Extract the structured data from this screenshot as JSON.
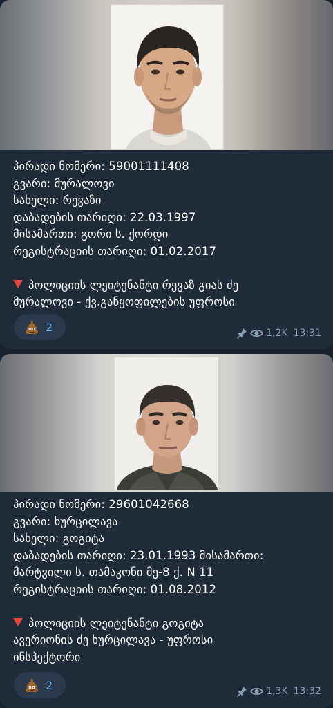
{
  "messages": [
    {
      "lines": [
        "პირადი ნომერი: 59001111408",
        "გვარი: მურალოვი",
        "სახელი: რევაზი",
        "დაბადების თარიღი: 22.03.1997",
        "მისამართი: გორი ს. ქორდი",
        "რეგისტრაციის თარიღი: 01.02.2017"
      ],
      "note_lines": [
        "პოლიციის ლეიტენანტი რევაზ გიას ძე",
        "მურალოვი - ქვ.განყოფილების უფროსი"
      ],
      "reaction_count": "2",
      "views": "1,2K",
      "time": "13:31"
    },
    {
      "lines": [
        "პირადი ნომერი: 29601042668",
        "გვარი: ხურცილავა",
        "სახელი: გოგიტა",
        "დაბადების თარიღი: 23.01.1993  მისამართი:",
        "მარტვილი ს. თამაკონი მე-8 ქ. N 11",
        "რეგისტრაციის თარიღი: 01.08.2012"
      ],
      "note_lines": [
        "პოლიციის ლეიტენანტი გოგიტა",
        "ავერიონის ძე ხურცილავა - უფროსი",
        "ინსპექტორი"
      ],
      "reaction_count": "2",
      "views": "1,3K",
      "time": "13:32"
    }
  ],
  "colors": {
    "background": "#18222d",
    "bubble": "#1f2b38",
    "reaction_bg": "#2a3a4c",
    "reaction_count": "#5eb5f7",
    "meta": "#8ea3b6",
    "triangle": "#e8453c"
  },
  "icons": {
    "reaction": "pile-of-poo-icon",
    "pin": "pin-icon",
    "views": "eye-icon",
    "note_marker": "red-triangle-down-icon"
  }
}
